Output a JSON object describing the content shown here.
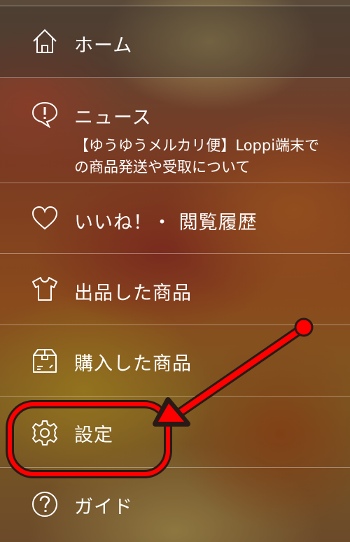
{
  "menu": {
    "items": [
      {
        "label": "ホーム",
        "icon": "home-icon"
      },
      {
        "label": "ニュース",
        "icon": "speech-bubble-alert-icon",
        "subtitle": "【ゆうゆうメルカリ便】Loppi端末での商品発送や受取について"
      },
      {
        "label": "いいね！・ 閲覧履歴",
        "icon": "heart-icon"
      },
      {
        "label": "出品した商品",
        "icon": "tshirt-icon"
      },
      {
        "label": "購入した商品",
        "icon": "box-icon"
      },
      {
        "label": "設定",
        "icon": "gear-icon"
      },
      {
        "label": "ガイド",
        "icon": "help-icon"
      }
    ]
  },
  "annotation": {
    "color": "#ff0000",
    "target": "設定"
  }
}
